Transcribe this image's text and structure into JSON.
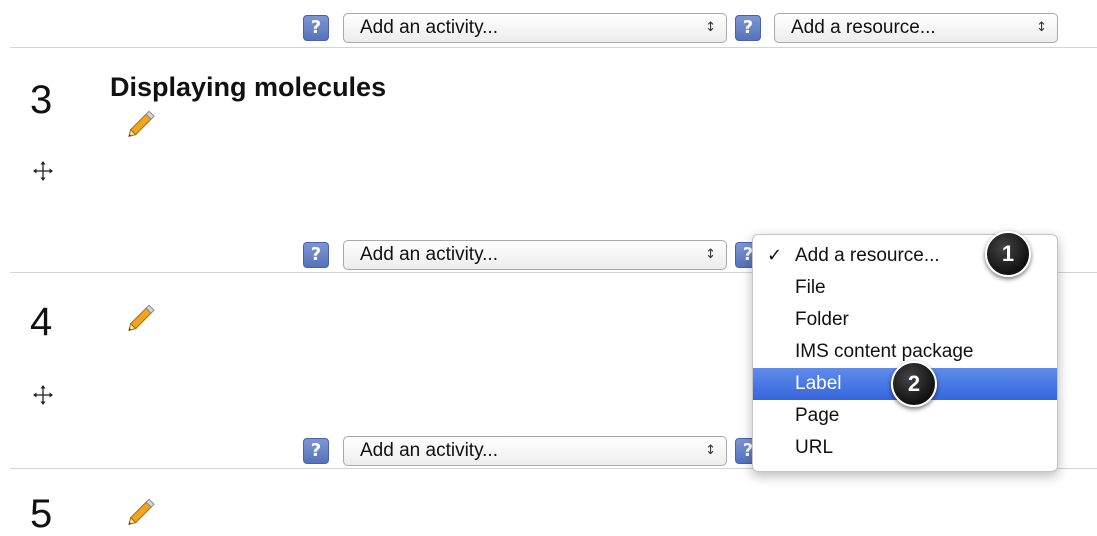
{
  "controls": {
    "activity_placeholder": "Add an activity...",
    "resource_placeholder": "Add a resource...",
    "help_glyph": "?",
    "select_arrows": "↕"
  },
  "sections": [
    {
      "number": "3",
      "title": "Displaying molecules"
    },
    {
      "number": "4",
      "title": ""
    },
    {
      "number": "5",
      "title": ""
    }
  ],
  "resource_menu": {
    "selected_check": "✓",
    "items": [
      {
        "label": "Add a resource...",
        "selected": true,
        "highlighted": false
      },
      {
        "label": "File",
        "selected": false,
        "highlighted": false
      },
      {
        "label": "Folder",
        "selected": false,
        "highlighted": false
      },
      {
        "label": "IMS content package",
        "selected": false,
        "highlighted": false
      },
      {
        "label": "Label",
        "selected": false,
        "highlighted": true
      },
      {
        "label": "Page",
        "selected": false,
        "highlighted": false
      },
      {
        "label": "URL",
        "selected": false,
        "highlighted": false
      }
    ]
  },
  "callouts": [
    "1",
    "2"
  ],
  "icons": [
    "help-icon",
    "pencil-icon",
    "move-icon",
    "select-arrows-icon",
    "checkmark-icon"
  ],
  "colors": {
    "help_icon": "#5f7bc4",
    "highlight": "#3f6fe0",
    "pencil": "#e8a21c",
    "callout": "#1a1a1a"
  }
}
